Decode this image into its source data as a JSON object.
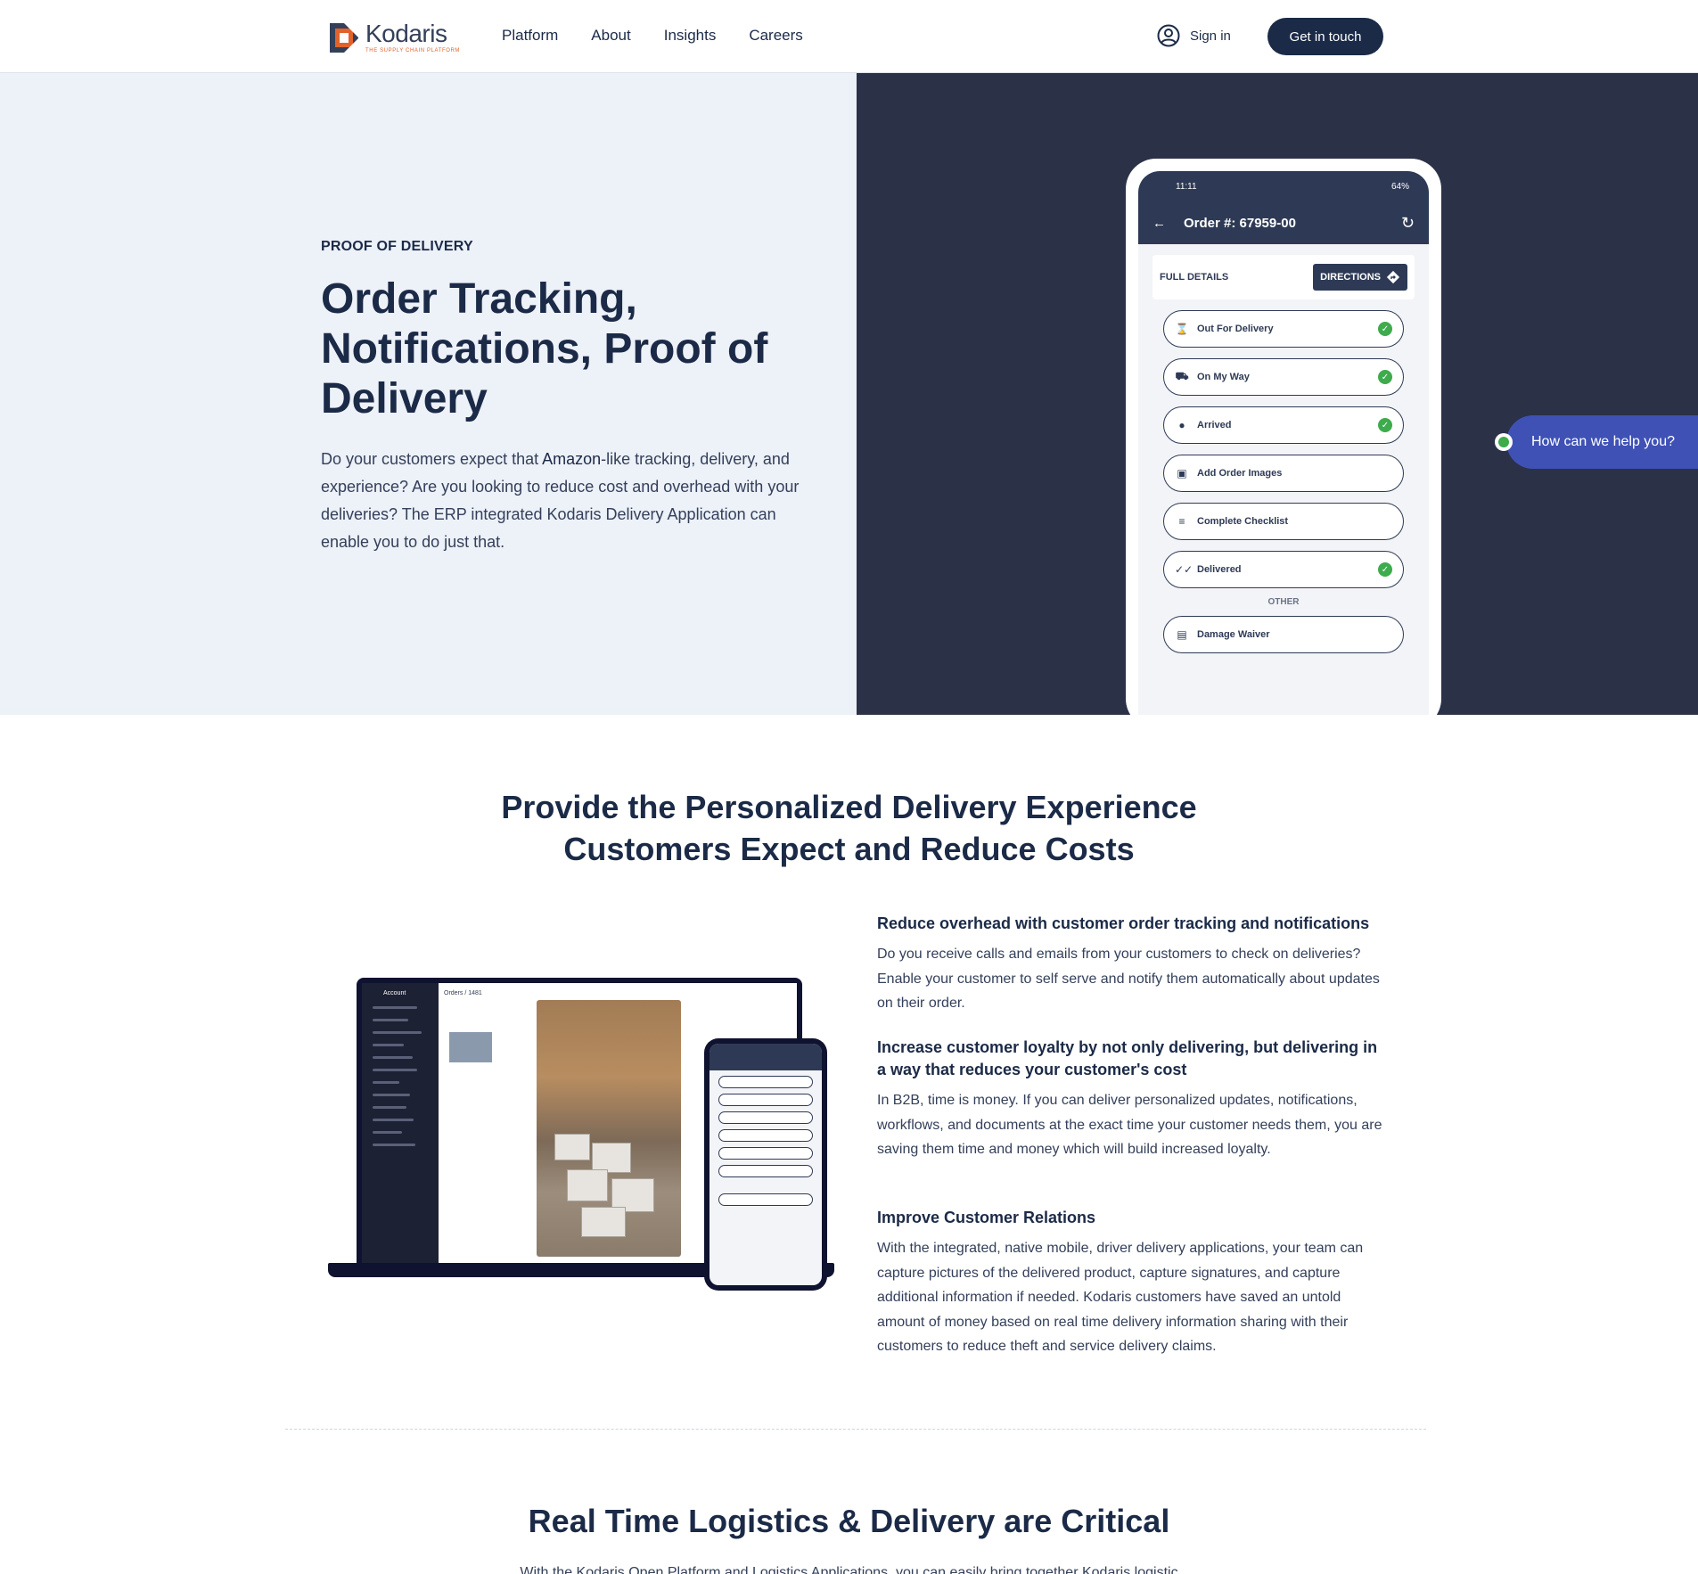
{
  "brand": {
    "name": "Kodaris",
    "tagline": "THE SUPPLY CHAIN PLATFORM",
    "accent": "#e2622b",
    "navy": "#1b2a47"
  },
  "nav": {
    "items": [
      "Platform",
      "About",
      "Insights",
      "Careers"
    ]
  },
  "header": {
    "signin_label": "Sign in",
    "cta_label": "Get in touch"
  },
  "hero": {
    "eyebrow": "PROOF OF DELIVERY",
    "title": "Order Tracking, Notifications, Proof of Delivery",
    "desc_pre": "Do your customers expect that ",
    "desc_bold": "Amazon",
    "desc_post": "-like tracking, delivery, and experience? Are you looking to reduce cost and overhead with your deliveries? The ERP integrated Kodaris Delivery Application can enable you to do just that."
  },
  "phone": {
    "time": "11:11",
    "battery": "64%",
    "order_title": "Order #: 67959-00",
    "full_details": "FULL DETAILS",
    "directions": "DIRECTIONS",
    "steps": [
      {
        "label": "Out For Delivery",
        "icon": "hourglass-icon",
        "done": true
      },
      {
        "label": "On My Way",
        "icon": "truck-icon",
        "done": true
      },
      {
        "label": "Arrived",
        "icon": "pin-icon",
        "done": true
      },
      {
        "label": "Add Order Images",
        "icon": "camera-icon",
        "done": false
      },
      {
        "label": "Complete Checklist",
        "icon": "checklist-icon",
        "done": false
      },
      {
        "label": "Delivered",
        "icon": "double-check-icon",
        "done": true
      }
    ],
    "other_label": "OTHER",
    "other_item": "Damage Waiver"
  },
  "chat": {
    "label": "How can we help you?"
  },
  "section2": {
    "title_line1": "Provide the Personalized Delivery Experience",
    "title_line2": "Customers Expect and Reduce Costs",
    "features": [
      {
        "heading": "Reduce overhead with customer order tracking and notifications",
        "body": "Do you receive calls and emails from your customers to check on deliveries? Enable your customer to self serve and notify them automatically about updates on their order."
      },
      {
        "heading": "Increase customer loyalty by not only delivering, but delivering in a way that reduces your customer's cost",
        "body": "In B2B, time is money. If you can deliver personalized updates, notifications, workflows, and documents at the exact time your customer needs them, you are saving them time and money which will build increased loyalty."
      },
      {
        "heading": "Improve Customer Relations",
        "body": "With the integrated, native mobile, driver delivery applications, your team can capture pictures of the delivered product, capture signatures, and capture additional information if needed. Kodaris customers have saved an untold amount of money based on real time delivery information sharing with their customers to reduce theft and service delivery claims."
      }
    ],
    "laptop": {
      "account_label": "Account",
      "breadcrumb": "Orders / 1481"
    }
  },
  "section3": {
    "title": "Real Time Logistics & Delivery are Critical",
    "intro": "With the Kodaris Open Platform and Logistics Applications, you can easily bring together Kodaris logistic"
  }
}
